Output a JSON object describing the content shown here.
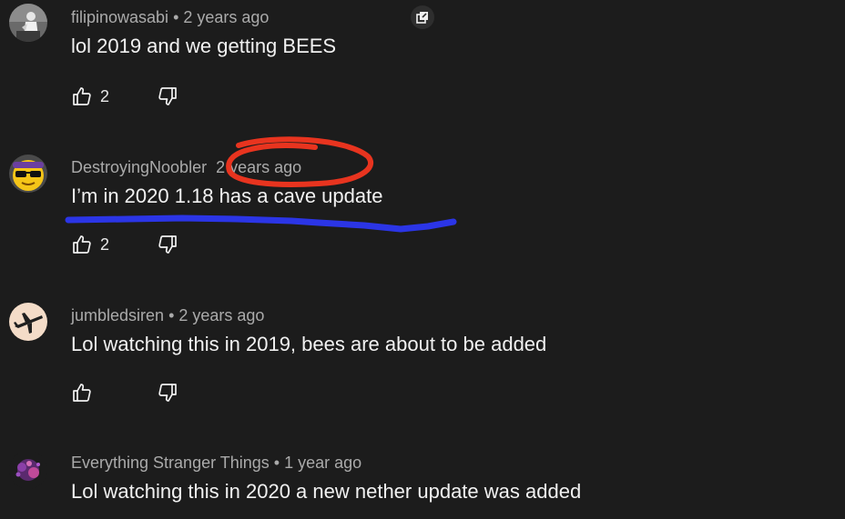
{
  "comments": [
    {
      "author": "filipinowasabi",
      "separator": "•",
      "time": "2 years ago",
      "text": "lol 2019 and we getting BEES",
      "likes": "2",
      "avatar": "bw-figure-avatar"
    },
    {
      "author": "DestroyingNoobler",
      "separator": "",
      "time": "2 years ago",
      "text": "I’m in  2020 1.18 has a cave update",
      "likes": "2",
      "avatar": "sunglasses-emoji-avatar"
    },
    {
      "author": "jumbledsiren",
      "separator": "•",
      "time": "2 years ago",
      "text": "Lol watching this in 2019, bees are about to be added",
      "likes": "",
      "avatar": "airplane-avatar"
    },
    {
      "author": "Everything Stranger Things",
      "separator": "•",
      "time": "1 year ago",
      "text": "Lol watching this in 2020 a new nether update was added",
      "likes": "",
      "avatar": "purple-splash-avatar"
    }
  ],
  "icons": {
    "like": "thumbs-up-icon",
    "dislike": "thumbs-down-icon",
    "popout": "open-in-new-icon"
  },
  "annotations": {
    "circle_color": "#e8341f",
    "underline_color": "#2b35e6"
  },
  "colors": {
    "background": "#1c1c1c",
    "meta": "#aaaaaa",
    "text": "#f1f1f1"
  }
}
